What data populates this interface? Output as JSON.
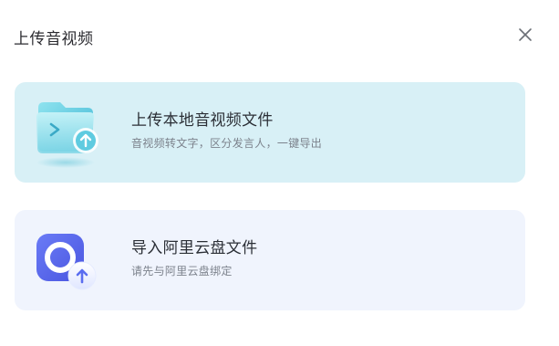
{
  "dialog": {
    "title": "上传音视频",
    "close_icon": "close-icon"
  },
  "options": [
    {
      "title": "上传本地音视频文件",
      "description": "音视频转文字，区分发言人，一键导出",
      "icon": "folder-upload-icon",
      "background": "#d8f0f6"
    },
    {
      "title": "导入阿里云盘文件",
      "description": "请先与阿里云盘绑定",
      "icon": "aliyun-drive-icon",
      "background": "#f0f4fd"
    }
  ],
  "colors": {
    "title_text": "#2b2f36",
    "desc_text": "#7c828c",
    "accent_teal": "#4fc3dc",
    "accent_blue": "#5a6df0"
  }
}
